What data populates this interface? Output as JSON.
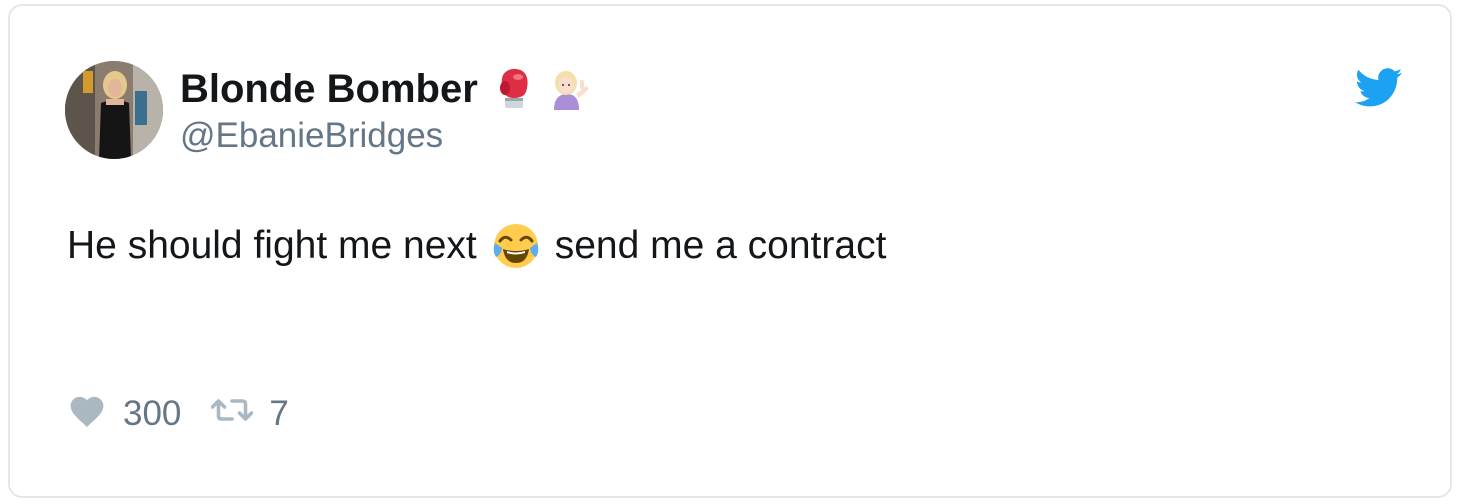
{
  "tweet": {
    "display_name": "Blonde Bomber",
    "name_emojis": [
      "boxing-glove-emoji",
      "woman-tipping-hand-emoji"
    ],
    "handle": "@EbanieBridges",
    "text_before": "He should fight me next",
    "inline_emoji": "face-with-tears-of-joy-emoji",
    "text_after": "send me a contract",
    "likes": "300",
    "retweets": "7"
  },
  "icons": {
    "like": "heart-icon",
    "retweet": "retweet-icon",
    "brand": "twitter-bird-icon"
  },
  "colors": {
    "twitter_blue": "#1da1f2",
    "text_primary": "#14171a",
    "text_secondary": "#657786",
    "icon_gray": "#aab8c2",
    "border": "#e1e8ed"
  }
}
